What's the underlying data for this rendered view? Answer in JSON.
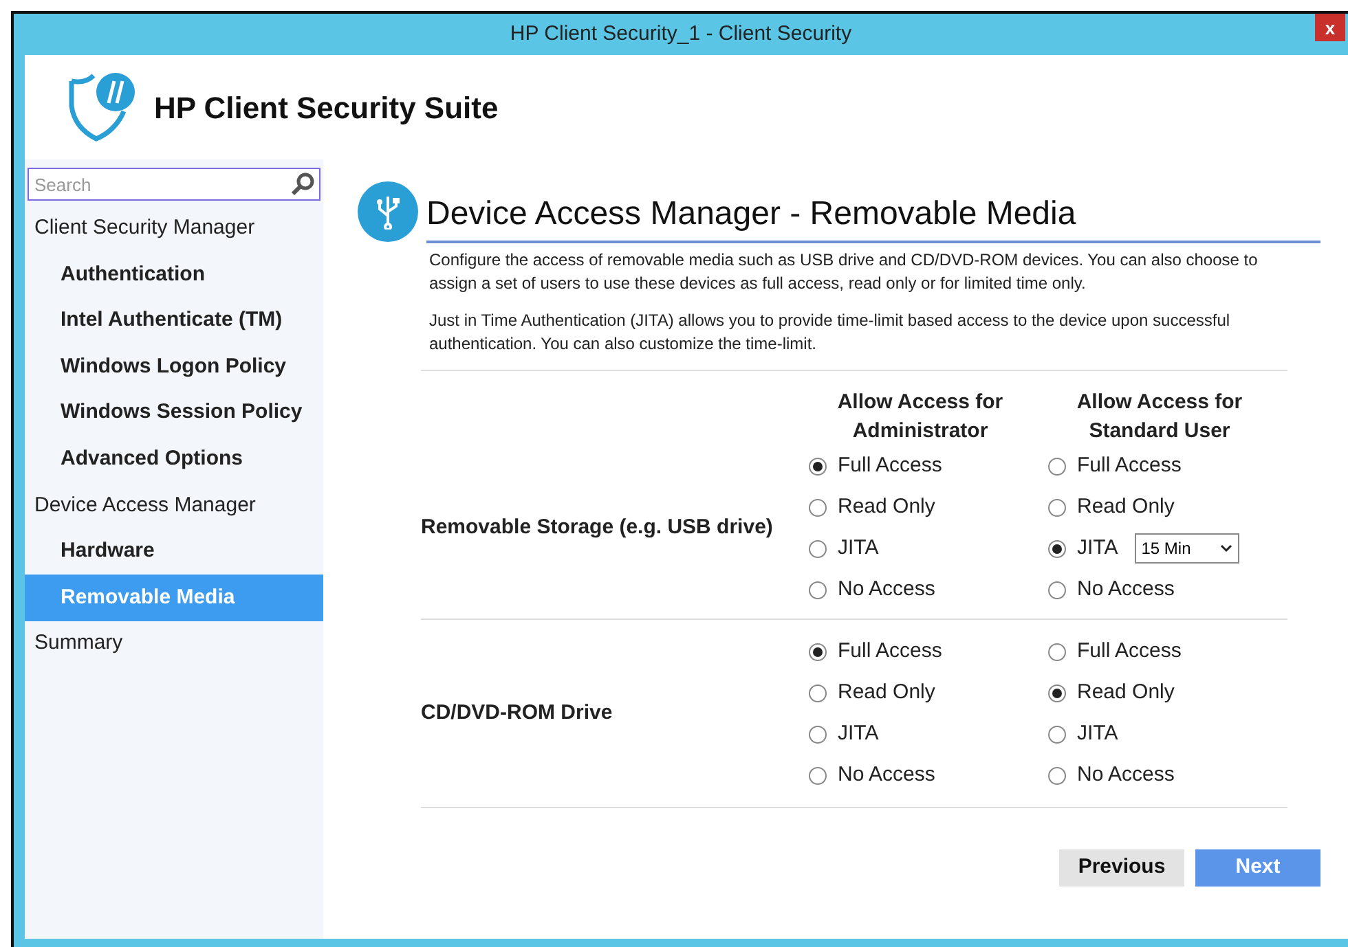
{
  "window": {
    "title": "HP Client Security_1 - Client Security",
    "close": "x"
  },
  "app": {
    "title": "HP Client Security Suite"
  },
  "sidebar": {
    "search": {
      "placeholder": "Search"
    },
    "items": [
      {
        "label": "Client Security Manager",
        "selected": false,
        "children": [
          {
            "label": "Authentication",
            "selected": false
          },
          {
            "label": "Intel Authenticate (TM)",
            "selected": false
          },
          {
            "label": "Windows Logon Policy",
            "selected": false
          },
          {
            "label": "Windows Session Policy",
            "selected": false
          },
          {
            "label": "Advanced Options",
            "selected": false
          }
        ]
      },
      {
        "label": "Device Access Manager",
        "selected": false,
        "children": [
          {
            "label": "Hardware",
            "selected": false
          },
          {
            "label": "Removable Media",
            "selected": true
          }
        ]
      },
      {
        "label": "Summary",
        "selected": false
      }
    ]
  },
  "page": {
    "title": "Device Access Manager - Removable Media",
    "paragraphs": [
      "Configure the access of removable media such as USB drive and CD/DVD-ROM devices. You can also choose to assign a set of users to use these devices as full access, read only or for limited time only.",
      "Just in Time Authentication (JITA) allows you to provide time-limit based access to the device upon successful authentication. You can also customize the time-limit."
    ],
    "columns": [
      "Allow Access for Administrator",
      "Allow Access for Standard User"
    ],
    "devices": [
      {
        "name": "Removable Storage (e.g. USB drive)",
        "administrator": [
          {
            "label": "Full Access",
            "selected": true
          },
          {
            "label": "Read Only",
            "selected": false
          },
          {
            "label": "JITA",
            "selected": false
          },
          {
            "label": "No Access",
            "selected": false
          }
        ],
        "standard_user": [
          {
            "label": "Full Access",
            "selected": false
          },
          {
            "label": "Read Only",
            "selected": false
          },
          {
            "label": "JITA",
            "selected": true,
            "time_limit": "15 Min"
          },
          {
            "label": "No Access",
            "selected": false
          }
        ]
      },
      {
        "name": "CD/DVD-ROM Drive",
        "administrator": [
          {
            "label": "Full Access",
            "selected": true
          },
          {
            "label": "Read Only",
            "selected": false
          },
          {
            "label": "JITA",
            "selected": false
          },
          {
            "label": "No Access",
            "selected": false
          }
        ],
        "standard_user": [
          {
            "label": "Full Access",
            "selected": false
          },
          {
            "label": "Read Only",
            "selected": true
          },
          {
            "label": "JITA",
            "selected": false
          },
          {
            "label": "No Access",
            "selected": false
          }
        ]
      }
    ]
  },
  "buttons": [
    {
      "label": "Previous",
      "kind": "secondary"
    },
    {
      "label": "Next",
      "kind": "primary"
    }
  ]
}
